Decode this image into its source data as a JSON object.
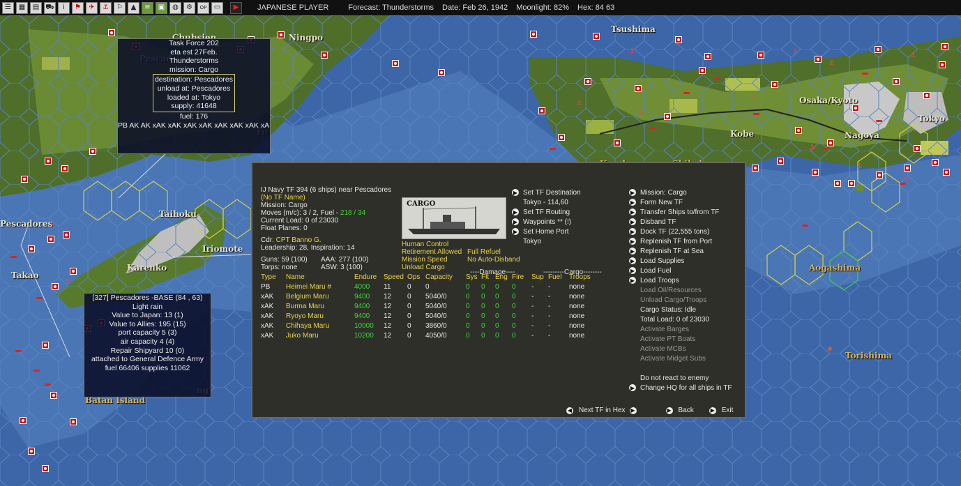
{
  "toolbar": {
    "buttons": [
      "list-icon",
      "grid-icon",
      "document-icon",
      "car-icon",
      "info-icon",
      "flag-icon",
      "plane-icon",
      "ship-icon",
      "flag-small-icon",
      "chart-icon",
      "stack-icon",
      "map-icon",
      "globe-icon",
      "gear-icon",
      "op-icon",
      "screen-icon"
    ],
    "status": {
      "player": "JAPANESE PLAYER",
      "forecast": "Forecast: Thunderstorms",
      "date": "Date: Feb 26, 1942",
      "moonlight": "Moonlight: 82%",
      "hex": "Hex: 84  63"
    }
  },
  "map": {
    "places": [
      "Chuhsien",
      "Ningpo",
      "Tsushima",
      "Kyushu",
      "Shikoku",
      "Osaka/Kyoto",
      "Kobe",
      "Nagoya",
      "Tokyo",
      "Aogashima",
      "Torishima",
      "Taihoku",
      "Pescadores",
      "Takao",
      "Iriomote",
      "Karenko",
      "Formosa",
      "Batan Island",
      "Pescad",
      "Fo",
      "ng"
    ],
    "colors": {
      "sea": "#3c66a8",
      "hex_line": "#4e7ab8",
      "land": "#5b7a2a",
      "tf_hex": "#d8d040"
    }
  },
  "tf_popup": {
    "title": "Task Force 202",
    "eta": "eta est 27Feb.",
    "weather": "Thunderstorms",
    "mission": "mission: Cargo",
    "destination": "destination: Pescadores",
    "unload": "unload at: Pescadores",
    "loaded": "loaded at: Tokyo",
    "supply": "supply: 41648",
    "fuel": "fuel: 176",
    "ships": "PB AK AK xAK xAK xAK xAK xAK xAK xAK xAK xAK"
  },
  "base_popup": {
    "title": "[327] Pescadores -BASE  (84 , 63)",
    "weather": "Light rain",
    "value_japan": "Value to Japan: 13 (1)",
    "value_allies": "Value to Allies: 195 (15)",
    "port_capacity": "port capacity 5 (3)",
    "air_capacity": "air capacity 4 (4)",
    "repair": "Repair Shipyard  10 (0)",
    "attached": "attached to General Defence Army",
    "supplies": "fuel 66406  supplies 11062"
  },
  "panel": {
    "header": "IJ Navy TF 394 (6 ships)  near Pescadores",
    "tf_name": "(No TF Name)",
    "mission": "Mission: Cargo",
    "moves_label": "Moves (m/c): 3 / 2, Fuel - ",
    "moves_fuel": "218 / 34",
    "current_load": "Current Load: 0 of 23030",
    "float_planes": "Float Planes: 0",
    "cdr_label": "Cdr: ",
    "cdr_name": "CPT Banno G.",
    "leadership": "Leadership: 28, Inspiration: 14",
    "guns": "Guns: 59 (100)",
    "aaa": "AAA: 277 (100)",
    "torps": "Torps: none",
    "asw": "ASW: 3 (100)",
    "ship_image_label": "CARGO",
    "flags": [
      "Human Control",
      "",
      "Retirement Allowed",
      "Full Refuel",
      "Mission Speed",
      "No Auto-Disband",
      "Unload Cargo",
      ""
    ],
    "table": {
      "damage_header": "----Damage----",
      "cargo_header": "---------Cargo--------",
      "columns": [
        "Type",
        "Name",
        "Endure",
        "Speed",
        "Ops",
        "Capacity",
        "Sys",
        "Flt",
        "Eng",
        "Fire",
        "Sup",
        "Fuel",
        "Troops"
      ],
      "rows": [
        [
          "PB",
          "Heimei Maru #",
          "4000",
          "11",
          "0",
          "0",
          "0",
          "0",
          "0",
          "0",
          "-",
          "-",
          "none"
        ],
        [
          "xAK",
          "Belgium Maru",
          "9400",
          "12",
          "0",
          "5040/0",
          "0",
          "0",
          "0",
          "0",
          "-",
          "-",
          "none"
        ],
        [
          "xAK",
          "Burma Maru",
          "9400",
          "12",
          "0",
          "5040/0",
          "0",
          "0",
          "0",
          "0",
          "-",
          "-",
          "none"
        ],
        [
          "xAK",
          "Ryoyo Maru",
          "9400",
          "12",
          "0",
          "5040/0",
          "0",
          "0",
          "0",
          "0",
          "-",
          "-",
          "none"
        ],
        [
          "xAK",
          "Chihaya Maru",
          "10000",
          "12",
          "0",
          "3860/0",
          "0",
          "0",
          "0",
          "0",
          "-",
          "-",
          "none"
        ],
        [
          "xAK",
          "Juko Maru",
          "10200",
          "12",
          "0",
          "4050/0",
          "0",
          "0",
          "0",
          "0",
          "-",
          "-",
          "none"
        ]
      ]
    },
    "mid_commands": [
      {
        "label": "Set TF Destination",
        "arrow": true
      },
      {
        "label": "Tokyo - 114,60",
        "arrow": false
      },
      {
        "label": "Set TF Routing",
        "arrow": true
      },
      {
        "label": "Waypoints ** (!)",
        "arrow": true
      },
      {
        "label": "Set Home Port",
        "arrow": true
      },
      {
        "label": "Tokyo",
        "arrow": false
      }
    ],
    "right_commands": [
      {
        "label": "Mission: Cargo",
        "arrow": true,
        "dim": false
      },
      {
        "label": "Form New TF",
        "arrow": true,
        "dim": false
      },
      {
        "label": "Transfer Ships to/from TF",
        "arrow": true,
        "dim": false
      },
      {
        "label": "Disband TF",
        "arrow": true,
        "dim": false
      },
      {
        "label": "Dock TF (22,555 tons)",
        "arrow": true,
        "dim": false
      },
      {
        "label": "Replenish TF from Port",
        "arrow": true,
        "dim": false
      },
      {
        "label": "Replenish TF at Sea",
        "arrow": true,
        "dim": false
      },
      {
        "label": "Load Supplies",
        "arrow": true,
        "dim": false
      },
      {
        "label": "Load Fuel",
        "arrow": true,
        "dim": false
      },
      {
        "label": "Load Troops",
        "arrow": true,
        "dim": false
      },
      {
        "label": "Load Oil/Resources",
        "arrow": false,
        "dim": true
      },
      {
        "label": "Unload Cargo/Troops",
        "arrow": false,
        "dim": true
      },
      {
        "label": "Cargo Status: Idle",
        "arrow": false,
        "dim": false
      },
      {
        "label": "Total Load: 0 of 23030",
        "arrow": false,
        "dim": false
      },
      {
        "label": "Activate Barges",
        "arrow": false,
        "dim": true
      },
      {
        "label": "Activate PT Boats",
        "arrow": false,
        "dim": true
      },
      {
        "label": "Activate MCBs",
        "arrow": false,
        "dim": true
      },
      {
        "label": "Activate Midget Subs",
        "arrow": false,
        "dim": true
      },
      {
        "label": "",
        "arrow": false,
        "dim": false
      },
      {
        "label": "Do not react to enemy",
        "arrow": false,
        "dim": false
      },
      {
        "label": "Change HQ for all ships in TF",
        "arrow": true,
        "dim": false
      }
    ],
    "nav": {
      "next": "Next TF in Hex",
      "back": "Back",
      "exit": "Exit"
    }
  }
}
